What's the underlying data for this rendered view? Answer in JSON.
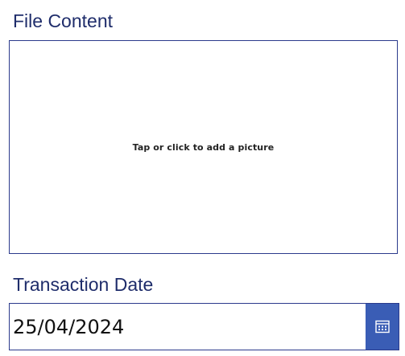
{
  "file_content": {
    "label": "File Content",
    "placeholder": "Tap or click to add a picture"
  },
  "transaction_date": {
    "label": "Transaction Date",
    "value": "25/04/2024",
    "icon": "calendar-icon"
  },
  "colors": {
    "label_text": "#1f2d6b",
    "border": "#2b3a8c",
    "calendar_button": "#3a5db5"
  }
}
